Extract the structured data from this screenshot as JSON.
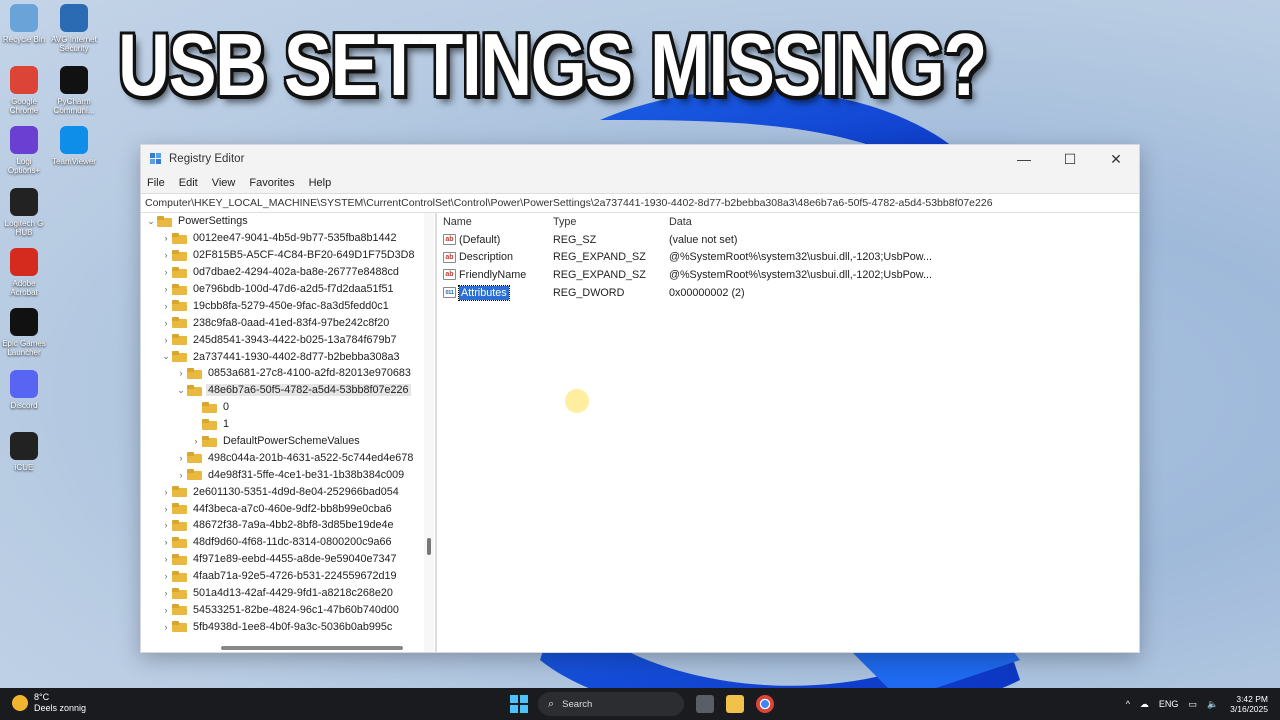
{
  "headline": "USB SETTINGS MISSING?",
  "desktop_icons": [
    {
      "label": "Recycle Bin",
      "icon": "recycle-bin-icon",
      "color": "#6aa3d8"
    },
    {
      "label": "AVG Internet Security",
      "icon": "avg-icon",
      "color": "#2a6bb3"
    },
    {
      "label": "Google Chrome",
      "icon": "chrome-icon",
      "color": "#db4437"
    },
    {
      "label": "PyCharm Communi...",
      "icon": "pycharm-icon",
      "color": "#111111"
    },
    {
      "label": "Logi Options+",
      "icon": "logi-options-icon",
      "color": "#6a3fd1"
    },
    {
      "label": "TeamViewer",
      "icon": "teamviewer-icon",
      "color": "#0e8ee9"
    },
    {
      "label": "Logitech G HUB",
      "icon": "logitech-ghub-icon",
      "color": "#222222"
    },
    {
      "label": "Adobe Acrobat",
      "icon": "acrobat-icon",
      "color": "#d52b1e"
    },
    {
      "label": "Epic Games Launcher",
      "icon": "epic-games-icon",
      "color": "#111111"
    },
    {
      "label": "Discord",
      "icon": "discord-icon",
      "color": "#5865f2"
    },
    {
      "label": "iCUE",
      "icon": "icue-icon",
      "color": "#222222"
    }
  ],
  "window": {
    "title": "Registry Editor",
    "controls": {
      "minimize": "—",
      "maximize": "☐",
      "close": "✕"
    },
    "menu": [
      "File",
      "Edit",
      "View",
      "Favorites",
      "Help"
    ],
    "address": "Computer\\HKEY_LOCAL_MACHINE\\SYSTEM\\CurrentControlSet\\Control\\Power\\PowerSettings\\2a737441-1930-4402-8d77-b2bebba308a3\\48e6b7a6-50f5-4782-a5d4-53bb8f07e226"
  },
  "tree": [
    {
      "label": "PowerSettings",
      "depth": 0,
      "expander": "⌄"
    },
    {
      "label": "0012ee47-9041-4b5d-9b77-535fba8b1442",
      "depth": 1,
      "expander": "›"
    },
    {
      "label": "02F815B5-A5CF-4C84-BF20-649D1F75D3D8",
      "depth": 1,
      "expander": "›"
    },
    {
      "label": "0d7dbae2-4294-402a-ba8e-26777e8488cd",
      "depth": 1,
      "expander": "›"
    },
    {
      "label": "0e796bdb-100d-47d6-a2d5-f7d2daa51f51",
      "depth": 1,
      "expander": "›"
    },
    {
      "label": "19cbb8fa-5279-450e-9fac-8a3d5fedd0c1",
      "depth": 1,
      "expander": "›"
    },
    {
      "label": "238c9fa8-0aad-41ed-83f4-97be242c8f20",
      "depth": 1,
      "expander": "›"
    },
    {
      "label": "245d8541-3943-4422-b025-13a784f679b7",
      "depth": 1,
      "expander": "›"
    },
    {
      "label": "2a737441-1930-4402-8d77-b2bebba308a3",
      "depth": 1,
      "expander": "⌄"
    },
    {
      "label": "0853a681-27c8-4100-a2fd-82013e970683",
      "depth": 2,
      "expander": "›"
    },
    {
      "label": "48e6b7a6-50f5-4782-a5d4-53bb8f07e226",
      "depth": 2,
      "expander": "⌄",
      "selected": true
    },
    {
      "label": "0",
      "depth": 3,
      "expander": ""
    },
    {
      "label": "1",
      "depth": 3,
      "expander": ""
    },
    {
      "label": "DefaultPowerSchemeValues",
      "depth": 3,
      "expander": "›"
    },
    {
      "label": "498c044a-201b-4631-a522-5c744ed4e678",
      "depth": 2,
      "expander": "›"
    },
    {
      "label": "d4e98f31-5ffe-4ce1-be31-1b38b384c009",
      "depth": 2,
      "expander": "›"
    },
    {
      "label": "2e601130-5351-4d9d-8e04-252966bad054",
      "depth": 1,
      "expander": "›"
    },
    {
      "label": "44f3beca-a7c0-460e-9df2-bb8b99e0cba6",
      "depth": 1,
      "expander": "›"
    },
    {
      "label": "48672f38-7a9a-4bb2-8bf8-3d85be19de4e",
      "depth": 1,
      "expander": "›"
    },
    {
      "label": "48df9d60-4f68-11dc-8314-0800200c9a66",
      "depth": 1,
      "expander": "›"
    },
    {
      "label": "4f971e89-eebd-4455-a8de-9e59040e7347",
      "depth": 1,
      "expander": "›"
    },
    {
      "label": "4faab71a-92e5-4726-b531-224559672d19",
      "depth": 1,
      "expander": "›"
    },
    {
      "label": "501a4d13-42af-4429-9fd1-a8218c268e20",
      "depth": 1,
      "expander": "›"
    },
    {
      "label": "54533251-82be-4824-96c1-47b60b740d00",
      "depth": 1,
      "expander": "›"
    },
    {
      "label": "5fb4938d-1ee8-4b0f-9a3c-5036b0ab995c",
      "depth": 1,
      "expander": "›"
    }
  ],
  "list": {
    "headers": [
      "Name",
      "Type",
      "Data"
    ],
    "rows": [
      {
        "name": "(Default)",
        "type": "REG_SZ",
        "data": "(value not set)",
        "icon": "ab"
      },
      {
        "name": "Description",
        "type": "REG_EXPAND_SZ",
        "data": "@%SystemRoot%\\system32\\usbui.dll,-1203;UsbPow...",
        "icon": "ab"
      },
      {
        "name": "FriendlyName",
        "type": "REG_EXPAND_SZ",
        "data": "@%SystemRoot%\\system32\\usbui.dll,-1202;UsbPow...",
        "icon": "ab"
      },
      {
        "name": "Attributes",
        "type": "REG_DWORD",
        "data": "0x00000002 (2)",
        "icon": "011",
        "selected": true
      }
    ]
  },
  "taskbar": {
    "weather_temp": "8°C",
    "weather_desc": "Deels zonnig",
    "search_label": "Search",
    "tray_chevron": "^",
    "language": "ENG",
    "time": "3:42 PM",
    "date": "3/16/2025"
  }
}
